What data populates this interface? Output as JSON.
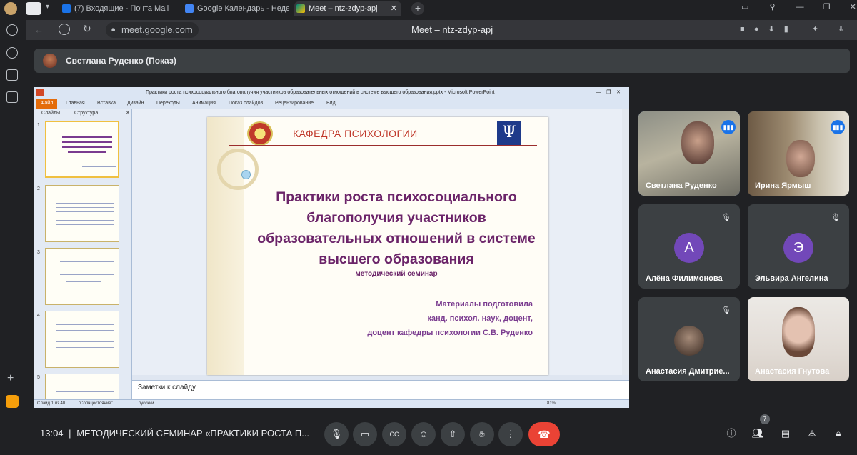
{
  "browser": {
    "tabs": [
      {
        "label": "(7) Входящие - Почта Mail"
      },
      {
        "label": "Google Календарь - Неде"
      },
      {
        "label": "Meet – ntz-zdyp-apj"
      }
    ],
    "url": "meet.google.com",
    "page_title": "Meet – ntz-zdyp-apj"
  },
  "presenter": {
    "label": "Светлана Руденко (Показ)"
  },
  "ppt": {
    "window_title": "Практики роста психосоциального благополучия участников образовательных отношений в системе высшего образования.pptx - Microsoft PowerPoint",
    "ribbon": [
      "Файл",
      "Главная",
      "Вставка",
      "Дизайн",
      "Переходы",
      "Анимация",
      "Показ слайдов",
      "Рецензирование",
      "Вид"
    ],
    "panel_tabs": [
      "Слайды",
      "Структура"
    ],
    "thumb_numbers": [
      "1",
      "2",
      "3",
      "4",
      "5"
    ],
    "slide": {
      "header": "КАФЕДРА ПСИХОЛОГИИ",
      "emblem_letter": "Ψ",
      "title": "Практики роста психосоциального благополучия участников образовательных отношений в системе высшего образования",
      "subtitle": "методический семинар",
      "author1": "Материалы подготовила",
      "author2": "канд. психол. наук, доцент,",
      "author3": "доцент кафедры психологии С.В. Руденко"
    },
    "notes": "Заметки к слайду",
    "status": {
      "slide": "Слайд 1 из 40",
      "theme": "\"Солнцестояние\"",
      "lang": "русский",
      "zoom": "81%"
    }
  },
  "participants": [
    {
      "name": "Светлана Руденко",
      "type": "video",
      "speaking": true
    },
    {
      "name": "Ирина Ярмыш",
      "type": "video",
      "speaking": true
    },
    {
      "name": "Алёна Филимонова",
      "type": "letter",
      "letter": "А",
      "color": "#7248b9",
      "muted": true
    },
    {
      "name": "Эльвира Ангелина",
      "type": "letter",
      "letter": "Э",
      "color": "#7248b9",
      "muted": true
    },
    {
      "name": "Анастасия Дмитрие...",
      "type": "photo",
      "muted": true
    },
    {
      "name": "Анастасия Гнутова",
      "type": "video",
      "speaking": false
    }
  ],
  "bottom": {
    "time": "13:04",
    "separator": "|",
    "meeting": "МЕТОДИЧЕСКИЙ СЕМИНАР «ПРАКТИКИ РОСТА П...",
    "people_count": "7"
  },
  "colors": {
    "accent": "#1a73e8",
    "hangup": "#ea4335",
    "background": "#202124",
    "tile": "#3c4043"
  }
}
